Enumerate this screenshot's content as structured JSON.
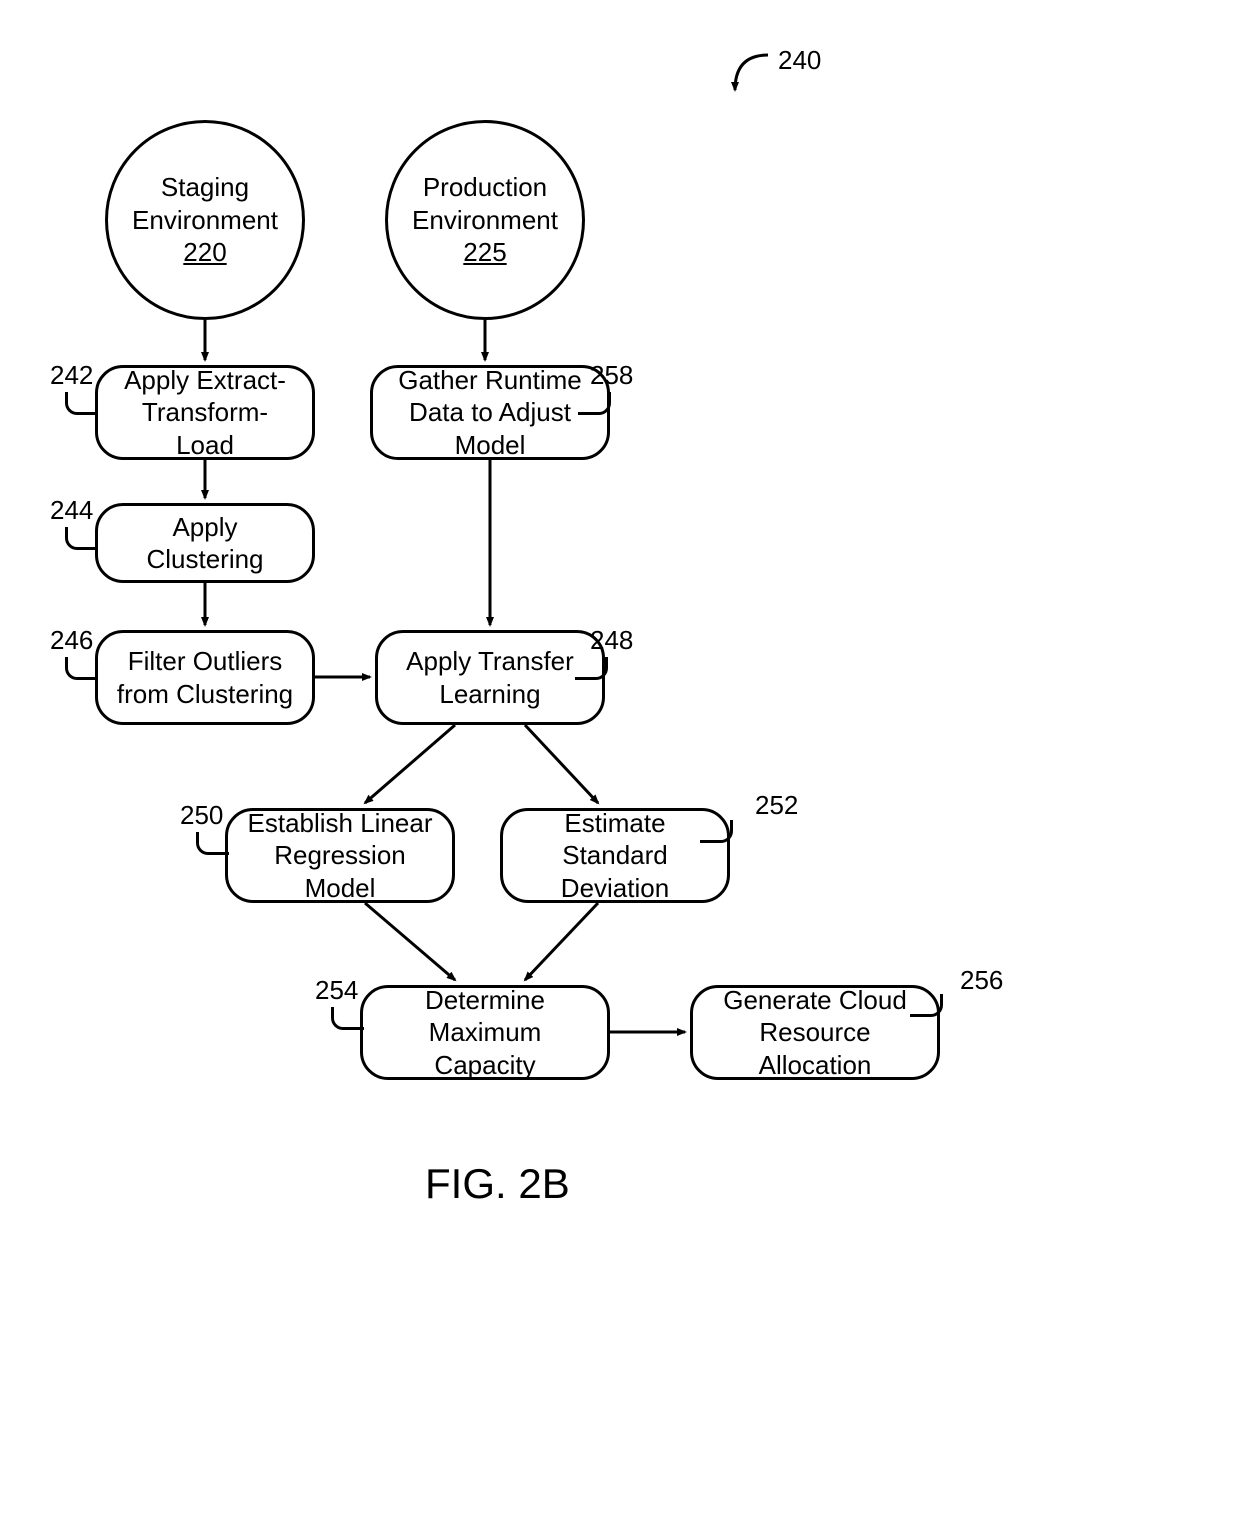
{
  "figure": {
    "reference_number": "240",
    "caption": "FIG. 2B"
  },
  "nodes": {
    "staging": {
      "line1": "Staging",
      "line2": "Environment",
      "ref": "220"
    },
    "production": {
      "line1": "Production",
      "line2": "Environment",
      "ref": "225"
    },
    "etl": {
      "text": "Apply Extract-Transform-Load",
      "ref": "242"
    },
    "clustering": {
      "text": "Apply Clustering",
      "ref": "244"
    },
    "filter": {
      "text": "Filter Outliers from Clustering",
      "ref": "246"
    },
    "gather": {
      "text": "Gather Runtime Data to Adjust Model",
      "ref": "258"
    },
    "transfer": {
      "text": "Apply Transfer Learning",
      "ref": "248"
    },
    "regression": {
      "text": "Establish Linear Regression Model",
      "ref": "250"
    },
    "stddev": {
      "text": "Estimate Standard Deviation",
      "ref": "252"
    },
    "maxcap": {
      "text": "Determine Maximum Capacity",
      "ref": "254"
    },
    "cloud": {
      "text": "Generate Cloud Resource Allocation",
      "ref": "256"
    }
  }
}
